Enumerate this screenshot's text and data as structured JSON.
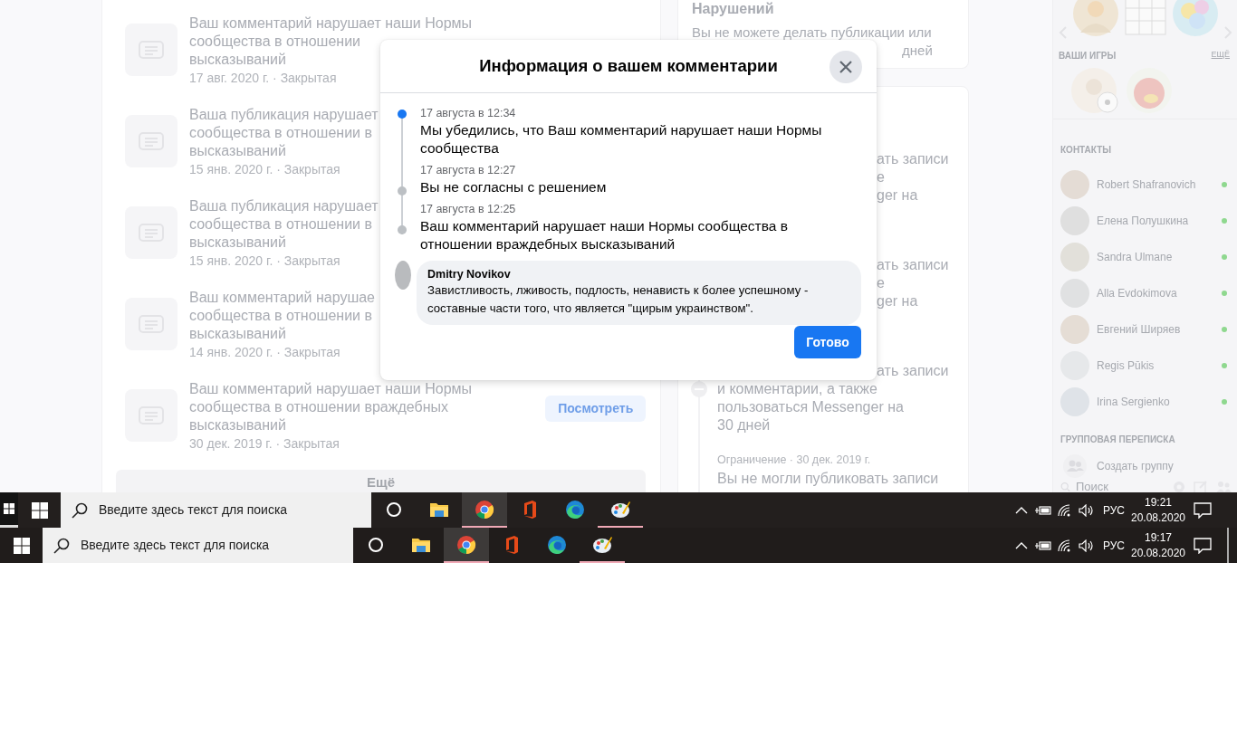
{
  "violations": {
    "items": [
      {
        "lines": [
          "Ваш комментарий нарушает наши Нормы",
          "сообщества в отношении",
          "высказываний"
        ],
        "meta": "17 авг. 2020 г. · Закрытая"
      },
      {
        "lines": [
          "Ваша публикация нарушает",
          "сообщества в отношении в",
          "высказываний"
        ],
        "meta": "15 янв. 2020 г. · Закрытая"
      },
      {
        "lines": [
          "Ваша публикация нарушает",
          "сообщества в отношении в",
          "высказываний"
        ],
        "meta": "15 янв. 2020 г. · Закрытая"
      },
      {
        "lines": [
          "Ваш комментарий нарушае",
          "сообщества в отношении в",
          "высказываний"
        ],
        "meta": "14 янв. 2020 г. · Закрытая"
      },
      {
        "lines": [
          "Ваш комментарий нарушает наши Нормы",
          "сообщества в отношении враждебных",
          "высказываний"
        ],
        "meta": "30 дек. 2019 г. · Закрытая",
        "button": "Посмотреть"
      }
    ],
    "more_button": "Ещё"
  },
  "restriction_card": {
    "title": "Нарушений",
    "lines": [
      {
        "kind": "full",
        "text": "Вы не можете делать публикации или"
      },
      {
        "kind": "tail",
        "text": "дней"
      }
    ]
  },
  "history_card": {
    "groups": [
      {
        "lines": [
          {
            "kind": "tail",
            "text": "ать записи"
          },
          {
            "kind": "tail",
            "text": "е"
          },
          {
            "kind": "tail",
            "text": "ger на"
          }
        ]
      },
      {
        "lines": [
          {
            "kind": "tail",
            "text": "ать записи"
          },
          {
            "kind": "tail",
            "text": "е"
          },
          {
            "kind": "tail",
            "text": "ger на"
          }
        ]
      },
      {
        "lines": [
          {
            "kind": "tail",
            "text": "ать записи"
          },
          {
            "kind": "full",
            "text": "и комментарии, а также"
          },
          {
            "kind": "full",
            "text": "пользоваться Messenger на"
          },
          {
            "kind": "full",
            "text": "30 дней"
          }
        ]
      },
      {
        "meta": "Ограничение · 30 дек. 2019 г.",
        "lines": [
          {
            "kind": "full",
            "text": "Вы не могли публиковать записи"
          }
        ]
      }
    ]
  },
  "sidebar": {
    "games_heading": "ВАШИ ИГРЫ",
    "games_more": "ЕЩЁ",
    "contacts_heading": "КОНТАКТЫ",
    "contacts": [
      {
        "name": "Robert Shafranovich",
        "online": true
      },
      {
        "name": "Елена Полушкина",
        "online": true
      },
      {
        "name": "Sandra Ulmane",
        "online": true
      },
      {
        "name": "Alla Evdokimova",
        "online": true
      },
      {
        "name": "Евгений Ширяев",
        "online": true
      },
      {
        "name": "Regis Pūkis",
        "online": true
      },
      {
        "name": "Irina Sergienko",
        "online": true
      }
    ],
    "group_heading": "ГРУППОВАЯ ПЕРЕПИСКА",
    "create_group": "Создать группу",
    "search": {
      "placeholder": "Поиск"
    }
  },
  "modal": {
    "title": "Информация о вашем комментарии",
    "timeline": [
      {
        "date": "17 августа в 12:34",
        "text": "Мы убедились, что Ваш комментарий нарушает наши Нормы сообщества",
        "selected": true
      },
      {
        "date": "17 августа в 12:27",
        "text": "Вы не согласны с решением",
        "selected": false
      },
      {
        "date": "17 августа в 12:25",
        "text": "Ваш комментарий нарушает наши Нормы сообщества в отношении враждебных высказываний",
        "selected": false
      }
    ],
    "comment": {
      "author": "Dmitry Novikov",
      "text": "Завистливость, лживость, подлость, ненависть к более успешному - составные части того, что является \"щирым украинством\"."
    },
    "done_button": "Готово"
  },
  "taskbars": [
    {
      "search": {
        "placeholder": "Введите здесь текст для поиска"
      },
      "apps": [
        {
          "kind": "folder",
          "active": false,
          "running": false
        },
        {
          "kind": "chrome",
          "active": true,
          "running": true
        },
        {
          "kind": "office",
          "active": false,
          "running": false
        },
        {
          "kind": "edge",
          "active": false,
          "running": false
        },
        {
          "kind": "paint",
          "active": false,
          "running": true
        }
      ],
      "language": "РУС",
      "time": "19:21",
      "date": "20.08.2020"
    },
    {
      "search": {
        "placeholder": "Введите здесь текст для поиска"
      },
      "apps": [
        {
          "kind": "folder",
          "active": false,
          "running": false
        },
        {
          "kind": "chrome",
          "active": true,
          "running": true
        },
        {
          "kind": "office",
          "active": false,
          "running": false
        },
        {
          "kind": "edge",
          "active": false,
          "running": false
        },
        {
          "kind": "paint",
          "active": false,
          "running": true
        }
      ],
      "language": "РУС",
      "time": "19:17",
      "date": "20.08.2020"
    }
  ]
}
